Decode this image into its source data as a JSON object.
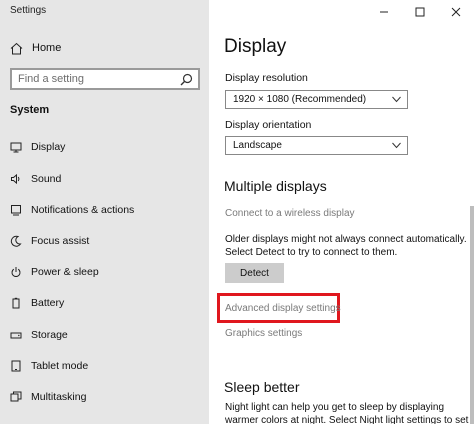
{
  "window": {
    "title": "Settings"
  },
  "sidebar": {
    "home_label": "Home",
    "search_placeholder": "Find a setting",
    "section_heading": "System",
    "items": [
      {
        "label": "Display",
        "icon": "monitor-icon"
      },
      {
        "label": "Sound",
        "icon": "speaker-icon"
      },
      {
        "label": "Notifications & actions",
        "icon": "notification-icon"
      },
      {
        "label": "Focus assist",
        "icon": "moon-icon"
      },
      {
        "label": "Power & sleep",
        "icon": "power-icon"
      },
      {
        "label": "Battery",
        "icon": "battery-icon"
      },
      {
        "label": "Storage",
        "icon": "storage-icon"
      },
      {
        "label": "Tablet mode",
        "icon": "tablet-icon"
      },
      {
        "label": "Multitasking",
        "icon": "multitasking-icon"
      }
    ]
  },
  "content": {
    "title": "Display",
    "resolution_label": "Display resolution",
    "resolution_value": "1920 × 1080 (Recommended)",
    "orientation_label": "Display orientation",
    "orientation_value": "Landscape",
    "multiple_displays_heading": "Multiple displays",
    "connect_wireless_link": "Connect to a wireless display",
    "older_displays_text": "Older displays might not always connect automatically. Select Detect to try to connect to them.",
    "detect_button": "Detect",
    "advanced_display_link": "Advanced display settings",
    "graphics_settings_link": "Graphics settings",
    "sleep_heading": "Sleep better",
    "night_light_text": "Night light can help you get to sleep by displaying warmer colors at night. Select Night light settings to set"
  },
  "colors": {
    "sidebar_bg": "#e6e6e6",
    "highlight_red": "#e0171e",
    "muted_link": "#7a7a7a"
  }
}
